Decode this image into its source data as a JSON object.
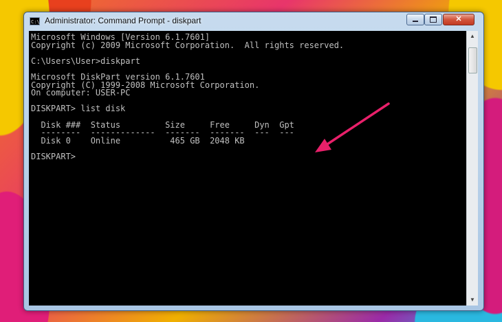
{
  "window": {
    "title": "Administrator: Command Prompt - diskpart",
    "icon_text": "C:\\"
  },
  "controls": {
    "minimize": "minimize-icon",
    "maximize": "maximize-icon",
    "close": "✕"
  },
  "console": {
    "lines": [
      "Microsoft Windows [Version 6.1.7601]",
      "Copyright (c) 2009 Microsoft Corporation.  All rights reserved.",
      "",
      "C:\\Users\\User>diskpart",
      "",
      "Microsoft DiskPart version 6.1.7601",
      "Copyright (C) 1999-2008 Microsoft Corporation.",
      "On computer: USER-PC",
      "",
      "DISKPART> list disk",
      "",
      "  Disk ###  Status         Size     Free     Dyn  Gpt",
      "  --------  -------------  -------  -------  ---  ---",
      "  Disk 0    Online          465 GB  2048 KB",
      "",
      "DISKPART> "
    ]
  },
  "scrollbar": {
    "up": "▲",
    "down": "▼"
  },
  "annotation": {
    "arrow_color": "#e8206a"
  }
}
